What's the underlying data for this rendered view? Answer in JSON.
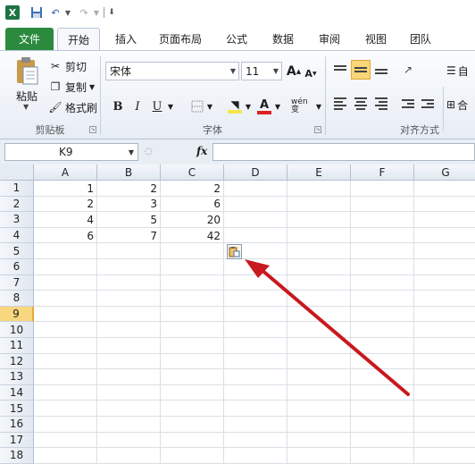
{
  "qat": {
    "logo_letter": "X"
  },
  "tabs": [
    "文件",
    "开始",
    "插入",
    "页面布局",
    "公式",
    "数据",
    "审阅",
    "视图",
    "团队"
  ],
  "ribbon": {
    "clipboard": {
      "paste": "粘贴",
      "cut": "剪切",
      "copy": "复制",
      "format_painter": "格式刷",
      "label": "剪贴板"
    },
    "font": {
      "name": "宋体",
      "size": "11",
      "bold": "B",
      "italic": "I",
      "underline": "U",
      "grow": "A",
      "shrink": "A",
      "phonetic": "wén 变",
      "label": "字体",
      "font_color": "#e02020",
      "highlight_color": "#f5e64b"
    },
    "alignment": {
      "label": "对齐方式",
      "wrap_partial": "自",
      "merge_partial": "合"
    }
  },
  "formula_bar": {
    "name_box": "K9",
    "fx": "fx",
    "formula": ""
  },
  "grid": {
    "columns": [
      "A",
      "B",
      "C",
      "D",
      "E",
      "F",
      "G"
    ],
    "rows": [
      "1",
      "2",
      "3",
      "4",
      "5",
      "6",
      "7",
      "8",
      "9",
      "10",
      "11",
      "12",
      "13",
      "14",
      "15",
      "16",
      "17",
      "18"
    ],
    "active_row": "9",
    "cells": [
      [
        "1",
        "2",
        "2"
      ],
      [
        "2",
        "3",
        "6"
      ],
      [
        "4",
        "5",
        "20"
      ],
      [
        "6",
        "7",
        "42"
      ]
    ]
  },
  "annotation": {
    "arrow_color": "#c8191e"
  }
}
